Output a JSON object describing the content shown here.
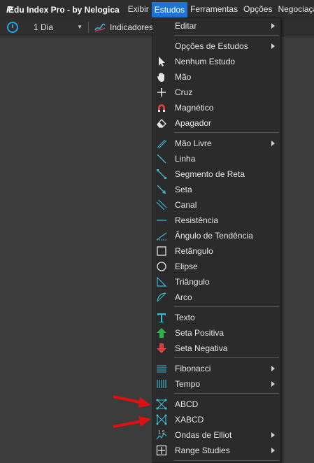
{
  "app": {
    "title": "Edu Index Pro - by Nelogica"
  },
  "menubar": {
    "items": [
      "Exibir",
      "Estudos",
      "Ferramentas",
      "Opções",
      "Negociação"
    ],
    "active": "Estudos"
  },
  "toolbar": {
    "period": "1 Dia",
    "indicators_label": "Indicadores"
  },
  "menu": {
    "items": [
      {
        "label": "Editar",
        "icon": "none",
        "submenu": true
      },
      {
        "label": "Opções de Estudos",
        "icon": "none",
        "submenu": true
      },
      {
        "label": "Nenhum Estudo",
        "icon": "cursor-arrow-icon",
        "submenu": false
      },
      {
        "label": "Mão",
        "icon": "hand-icon",
        "submenu": false
      },
      {
        "label": "Cruz",
        "icon": "crosshair-icon",
        "submenu": false
      },
      {
        "label": "Magnético",
        "icon": "magnet-icon",
        "submenu": false
      },
      {
        "label": "Apagador",
        "icon": "eraser-icon",
        "submenu": false
      },
      {
        "label": "Mão Livre",
        "icon": "freehand-icon",
        "submenu": true
      },
      {
        "label": "Linha",
        "icon": "line-icon",
        "submenu": false
      },
      {
        "label": "Segmento de Reta",
        "icon": "segment-icon",
        "submenu": false
      },
      {
        "label": "Seta",
        "icon": "arrow-line-icon",
        "submenu": false
      },
      {
        "label": "Canal",
        "icon": "channel-icon",
        "submenu": false
      },
      {
        "label": "Resistência",
        "icon": "horizontal-line-icon",
        "submenu": false
      },
      {
        "label": "Ângulo de Tendência",
        "icon": "trend-angle-icon",
        "submenu": false
      },
      {
        "label": "Retângulo",
        "icon": "rectangle-icon",
        "submenu": false
      },
      {
        "label": "Elipse",
        "icon": "ellipse-icon",
        "submenu": false
      },
      {
        "label": "Triângulo",
        "icon": "triangle-icon",
        "submenu": false
      },
      {
        "label": "Arco",
        "icon": "arc-icon",
        "submenu": false
      },
      {
        "label": "Texto",
        "icon": "text-icon",
        "submenu": false
      },
      {
        "label": "Seta Positiva",
        "icon": "up-arrow-icon",
        "submenu": false
      },
      {
        "label": "Seta Negativa",
        "icon": "down-arrow-icon",
        "submenu": false
      },
      {
        "label": "Fibonacci",
        "icon": "fibonacci-icon",
        "submenu": true
      },
      {
        "label": "Tempo",
        "icon": "time-lines-icon",
        "submenu": true
      },
      {
        "label": "ABCD",
        "icon": "abcd-icon",
        "submenu": false
      },
      {
        "label": "XABCD",
        "icon": "xabcd-icon",
        "submenu": false
      },
      {
        "label": "Ondas de Elliot",
        "icon": "elliot-waves-icon",
        "submenu": true
      },
      {
        "label": "Range Studies",
        "icon": "range-studies-icon",
        "submenu": true
      }
    ]
  },
  "colors": {
    "accent": "#1e73d6",
    "icon_teal": "#3fb8d0",
    "positive": "#2eb34a",
    "negative": "#d94040",
    "annotation_arrow": "#e01010"
  }
}
